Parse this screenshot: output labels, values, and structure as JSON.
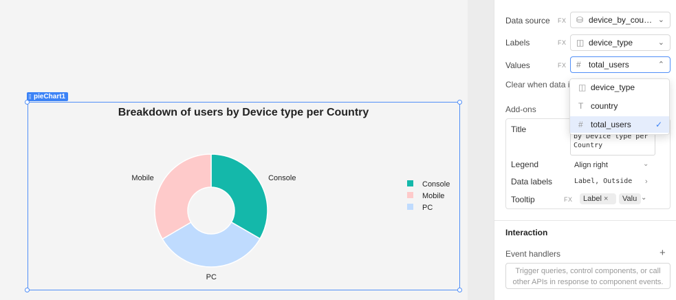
{
  "canvas": {
    "component_label": "pieChart1",
    "chart_title": "Breakdown of users by Device type per Country"
  },
  "chart_data": {
    "type": "pie",
    "donut": true,
    "title": "Breakdown of users by Device type per Country",
    "categories": [
      "Console",
      "PC",
      "Mobile"
    ],
    "values": [
      33.3,
      33.3,
      33.4
    ],
    "colors": [
      "#14b8aa",
      "#bfdbfe",
      "#fecaca"
    ],
    "legend": {
      "placement": "right",
      "items": [
        {
          "label": "Console",
          "color": "#14b8aa"
        },
        {
          "label": "Mobile",
          "color": "#fecaca"
        },
        {
          "label": "PC",
          "color": "#bfdbfe"
        }
      ]
    },
    "data_labels": [
      "Console",
      "PC",
      "Mobile"
    ]
  },
  "panel": {
    "content": {
      "data_source_label": "Data source",
      "data_source_value": "device_by_country",
      "labels_label": "Labels",
      "labels_value": "device_type",
      "values_label": "Values",
      "values_value": "total_users",
      "fx": "FX",
      "clear_label": "Clear when data is"
    },
    "dropdown": {
      "options": [
        {
          "label": "device_type",
          "icon": "tag-icon",
          "selected": false
        },
        {
          "label": "country",
          "icon": "text-icon",
          "selected": false
        },
        {
          "label": "total_users",
          "icon": "hash-icon",
          "selected": true
        }
      ]
    },
    "addons": {
      "label": "Add-ons",
      "title_label": "Title",
      "title_value": "by Device type per Country",
      "legend_label": "Legend",
      "legend_value": "Align right",
      "data_labels_label": "Data labels",
      "data_labels_value": "Label, Outside",
      "tooltip_label": "Tooltip",
      "tooltip_fx": "FX",
      "tooltip_chips": [
        "Label",
        "Valu"
      ]
    },
    "interaction": {
      "label": "Interaction",
      "events_label": "Event handlers",
      "events_placeholder": "Trigger queries, control components, or call other APIs in response to component events."
    }
  }
}
